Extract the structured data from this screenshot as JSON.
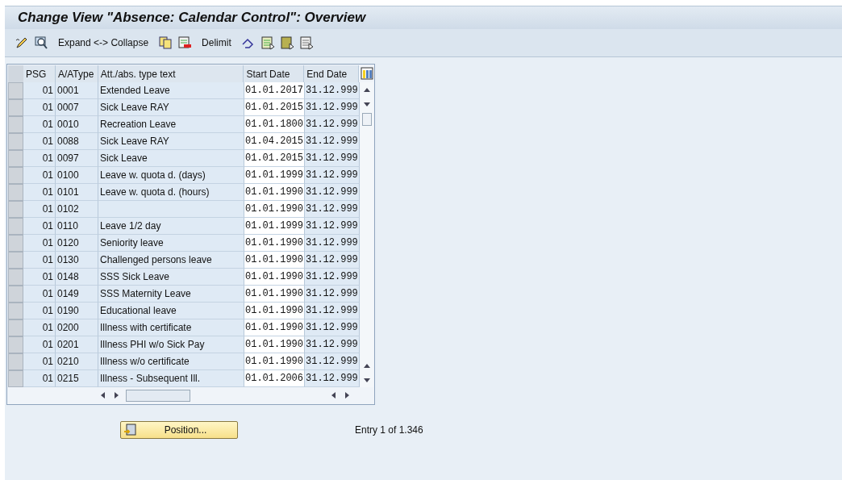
{
  "window": {
    "title": "Change View \"Absence: Calendar Control\": Overview"
  },
  "toolbar": {
    "expand_collapse": "Expand <-> Collapse",
    "delimit": "Delimit"
  },
  "table": {
    "columns": [
      "PSG",
      "A/AType",
      "Att./abs. type text",
      "Start Date",
      "End Date"
    ],
    "rows": [
      {
        "psg": "01",
        "type": "0001",
        "text": "Extended Leave",
        "start": "01.01.2017",
        "end": "31.12.999"
      },
      {
        "psg": "01",
        "type": "0007",
        "text": "Sick Leave RAY",
        "start": "01.01.2015",
        "end": "31.12.999"
      },
      {
        "psg": "01",
        "type": "0010",
        "text": "Recreation Leave",
        "start": "01.01.1800",
        "end": "31.12.999"
      },
      {
        "psg": "01",
        "type": "0088",
        "text": "Sick Leave RAY",
        "start": "01.04.2015",
        "end": "31.12.999"
      },
      {
        "psg": "01",
        "type": "0097",
        "text": "Sick Leave",
        "start": "01.01.2015",
        "end": "31.12.999"
      },
      {
        "psg": "01",
        "type": "0100",
        "text": "Leave w. quota d. (days)",
        "start": "01.01.1999",
        "end": "31.12.999"
      },
      {
        "psg": "01",
        "type": "0101",
        "text": "Leave w. quota d. (hours)",
        "start": "01.01.1990",
        "end": "31.12.999"
      },
      {
        "psg": "01",
        "type": "0102",
        "start": "01.01.1990",
        "end": "31.12.999"
      },
      {
        "psg": "01",
        "type": "0110",
        "text": "Leave 1/2 day",
        "start": "01.01.1999",
        "end": "31.12.999"
      },
      {
        "psg": "01",
        "type": "0120",
        "text": "Seniority leave",
        "start": "01.01.1990",
        "end": "31.12.999"
      },
      {
        "psg": "01",
        "type": "0130",
        "text": "Challenged persons leave",
        "start": "01.01.1990",
        "end": "31.12.999"
      },
      {
        "psg": "01",
        "type": "0148",
        "text": "SSS Sick Leave",
        "start": "01.01.1990",
        "end": "31.12.999"
      },
      {
        "psg": "01",
        "type": "0149",
        "text": "SSS Maternity Leave",
        "start": "01.01.1990",
        "end": "31.12.999"
      },
      {
        "psg": "01",
        "type": "0190",
        "text": "Educational leave",
        "start": "01.01.1990",
        "end": "31.12.999"
      },
      {
        "psg": "01",
        "type": "0200",
        "text": "Illness with certificate",
        "start": "01.01.1990",
        "end": "31.12.999"
      },
      {
        "psg": "01",
        "type": "0201",
        "text": "Illness PHI w/o Sick Pay",
        "start": "01.01.1990",
        "end": "31.12.999"
      },
      {
        "psg": "01",
        "type": "0210",
        "text": "Illness w/o certificate",
        "start": "01.01.1990",
        "end": "31.12.999"
      },
      {
        "psg": "01",
        "type": "0215",
        "text": "Illness - Subsequent Ill.",
        "start": "01.01.2006",
        "end": "31.12.999"
      }
    ]
  },
  "position_button": {
    "label": "Position..."
  },
  "entry_info": "Entry 1 of 1.346"
}
